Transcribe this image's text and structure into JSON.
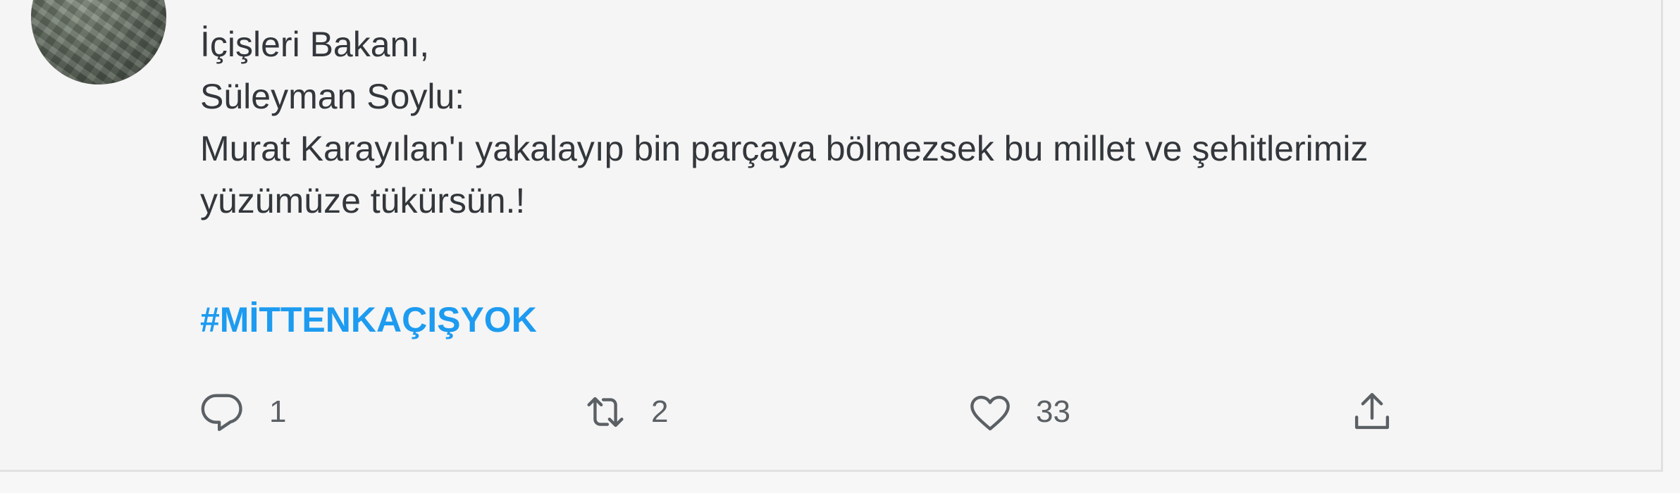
{
  "tweet": {
    "lines": [
      "İçişleri Bakanı,",
      "Süleyman Soylu:",
      "Murat Karayılan'ı yakalayıp bin parçaya bölmezsek bu millet ve şehitlerimiz",
      "yüzümüze tükürsün.!"
    ],
    "hashtag": "#MİTTENKAÇIŞYOK"
  },
  "actions": {
    "reply": {
      "icon": "reply-icon",
      "count": "1"
    },
    "retweet": {
      "icon": "retweet-icon",
      "count": "2"
    },
    "like": {
      "icon": "heart-icon",
      "count": "33"
    },
    "share": {
      "icon": "share-icon"
    }
  },
  "colors": {
    "text": "#33373b",
    "hashtag": "#1d9bf0",
    "icon": "#5b6065",
    "background": "#f5f5f5"
  }
}
